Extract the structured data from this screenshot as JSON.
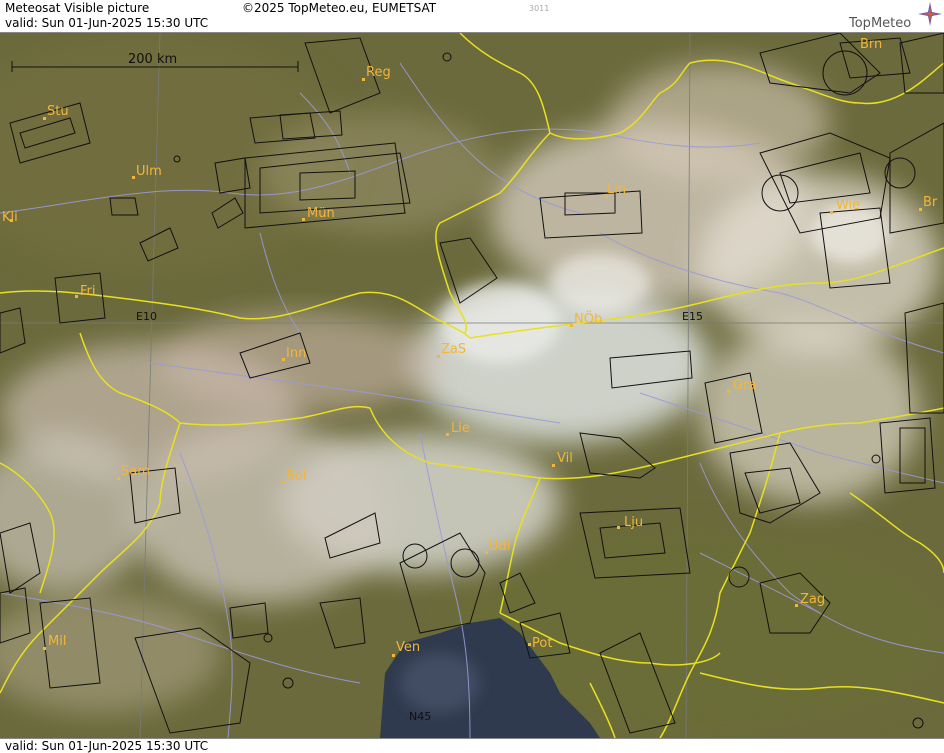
{
  "header": {
    "title": "Meteosat Visible picture",
    "valid": "valid:  Sun  01-Jun-2025  15:30 UTC",
    "copyright": "©2025 TopMeteo.eu, EUMETSAT",
    "image_number": "3011",
    "logo_text": "TopMeteo"
  },
  "footer": {
    "valid": "valid:  Sun  01-Jun-2025  15:30 UTC"
  },
  "scale": {
    "label": "200 km"
  },
  "grid_labels": [
    "E10",
    "E15",
    "N45"
  ],
  "cities": [
    {
      "name": "Reg"
    },
    {
      "name": "Brn"
    },
    {
      "name": "Stu"
    },
    {
      "name": "Ulm"
    },
    {
      "name": "Mün"
    },
    {
      "name": "Lin"
    },
    {
      "name": "Wie"
    },
    {
      "name": "Br"
    },
    {
      "name": "Kli"
    },
    {
      "name": "Fri"
    },
    {
      "name": "NÖb"
    },
    {
      "name": "Inn"
    },
    {
      "name": "ZaS"
    },
    {
      "name": "Gra"
    },
    {
      "name": "Lie"
    },
    {
      "name": "Vil"
    },
    {
      "name": "Sam"
    },
    {
      "name": "Bol"
    },
    {
      "name": "Lju"
    },
    {
      "name": "Udi"
    },
    {
      "name": "Zag"
    },
    {
      "name": "Mil"
    },
    {
      "name": "Ven"
    },
    {
      "name": "Pot"
    }
  ],
  "colors": {
    "border": "#e8e020",
    "river": "#9a9ad8",
    "airspace": "#111111",
    "city": "#f2b63a",
    "sea": "#2f3a4e",
    "land": "#6b6a3c"
  }
}
